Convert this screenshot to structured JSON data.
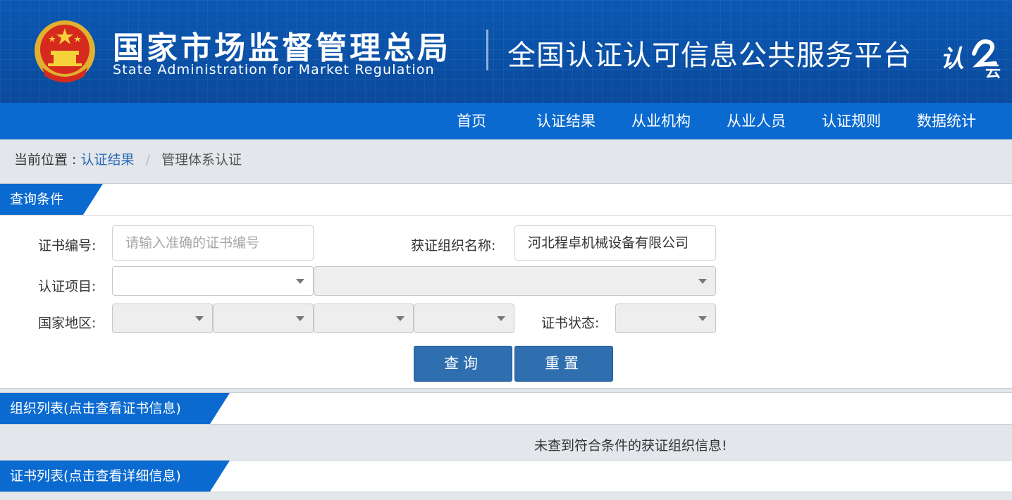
{
  "header": {
    "agency_cn": "国家市场监督管理总局",
    "agency_en": "State Administration  for  Market Regulation",
    "platform_title": "全国认证认可信息公共服务平台",
    "logo_text": "认",
    "logo_sub": "云",
    "emblem_icon": "national-emblem-icon",
    "colors": {
      "banner": "#0a4fa3",
      "nav": "#0a6ad0",
      "tab": "#0a6ad0"
    }
  },
  "nav": {
    "items": [
      {
        "label": "首页"
      },
      {
        "label": "认证结果"
      },
      {
        "label": "从业机构"
      },
      {
        "label": "从业人员"
      },
      {
        "label": "认证规则"
      },
      {
        "label": "数据统计"
      }
    ]
  },
  "breadcrumb": {
    "prefix": "当前位置 :",
    "link": "认证结果",
    "separator": "/",
    "current": "管理体系认证"
  },
  "query": {
    "section_title": "查询条件",
    "cert_no_label": "证书编号:",
    "cert_no_placeholder": "请输入准确的证书编号",
    "org_name_label": "获证组织名称:",
    "org_name_value": "河北程卓机械设备有限公司",
    "project_label": "认证项目:",
    "region_label": "国家地区:",
    "status_label": "证书状态:",
    "search_button": "查询",
    "reset_button": "重置"
  },
  "org_list": {
    "section_title": "组织列表(点击查看证书信息)",
    "empty_message": "未查到符合条件的获证组织信息!"
  },
  "cert_list": {
    "section_title": "证书列表(点击查看详细信息)"
  }
}
